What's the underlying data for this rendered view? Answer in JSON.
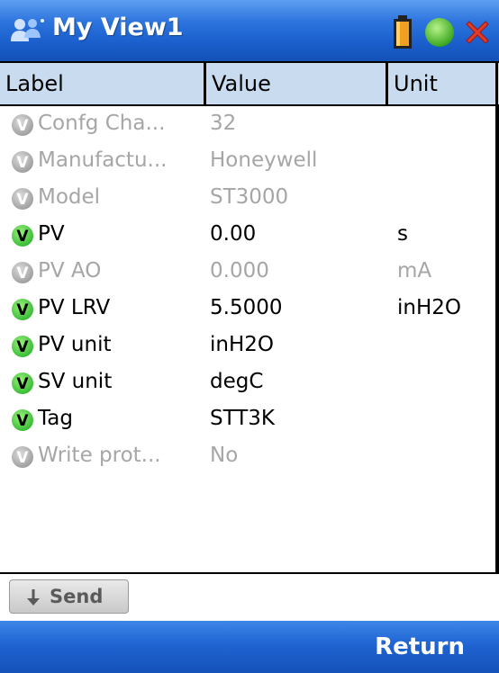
{
  "window": {
    "title": "My View1",
    "icons": [
      "people-icon",
      "battery-icon",
      "status-dot-icon",
      "close-icon"
    ],
    "colors": {
      "titlebar": "#1a5fcc",
      "status_dot": "#3fbf1f",
      "close": "#e03a2a",
      "battery": "#f0a020"
    }
  },
  "table": {
    "columns": [
      "Label",
      "Value",
      "Unit"
    ],
    "rows": [
      {
        "label": "Confg Cha...",
        "value": "32",
        "unit": "",
        "enabled": false
      },
      {
        "label": "Manufactu...",
        "value": "Honeywell",
        "unit": "",
        "enabled": false
      },
      {
        "label": "Model",
        "value": "ST3000",
        "unit": "",
        "enabled": false
      },
      {
        "label": "PV",
        "value": "0.00",
        "unit": "s",
        "enabled": true
      },
      {
        "label": "PV AO",
        "value": "0.000",
        "unit": "mA",
        "enabled": false
      },
      {
        "label": "PV LRV",
        "value": "5.5000",
        "unit": "inH2O",
        "enabled": true
      },
      {
        "label": "PV unit",
        "value": "inH2O",
        "unit": "",
        "enabled": true
      },
      {
        "label": "SV unit",
        "value": "degC",
        "unit": "",
        "enabled": true
      },
      {
        "label": "Tag",
        "value": "STT3K",
        "unit": "",
        "enabled": true
      },
      {
        "label": "Write prot...",
        "value": "No",
        "unit": "",
        "enabled": false
      }
    ],
    "row_icon": "V",
    "colors": {
      "enabled_text": "#000000",
      "disabled_text": "#a6a6a6",
      "enabled_icon": "#2fb82f",
      "disabled_icon": "#9a9a9a",
      "header_bg": "#c9dbef"
    }
  },
  "toolbar": {
    "send_label": "Send"
  },
  "footer": {
    "return_label": "Return"
  }
}
